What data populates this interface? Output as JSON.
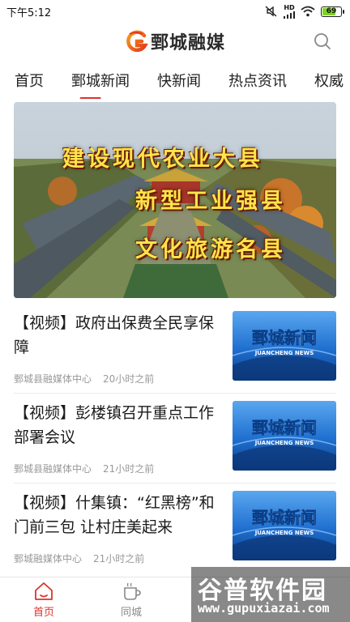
{
  "status_bar": {
    "time": "下午5:12",
    "network": "HD",
    "battery": "69"
  },
  "header": {
    "app_name": "鄄城融媒"
  },
  "tabs": [
    {
      "label": "首页"
    },
    {
      "label": "鄄城新闻"
    },
    {
      "label": "快新闻"
    },
    {
      "label": "热点资讯"
    },
    {
      "label": "权威"
    }
  ],
  "banner": {
    "lines": [
      "建设现代农业大县",
      "新型工业强县",
      "文化旅游名县"
    ]
  },
  "news": [
    {
      "title": "【视频】政府出保费全民享保障",
      "source": "鄄城县融媒体中心",
      "time": "20小时之前",
      "thumb_title": "鄄城新闻",
      "thumb_sub": "JUANCHENG NEWS"
    },
    {
      "title": "【视频】彭楼镇召开重点工作部署会议",
      "source": "鄄城县融媒体中心",
      "time": "21小时之前",
      "thumb_title": "鄄城新闻",
      "thumb_sub": "JUANCHENG NEWS"
    },
    {
      "title": "【视频】什集镇：“红黑榜”和门前三包 让村庄美起来",
      "source": "鄄城融媒体中心",
      "time": "21小时之前",
      "thumb_title": "鄄城新闻",
      "thumb_sub": "JUANCHENG NEWS"
    }
  ],
  "bottom_nav": [
    {
      "label": "首页",
      "icon": "home-icon"
    },
    {
      "label": "同城",
      "icon": "coffee-cup-icon"
    }
  ],
  "watermark": {
    "big": "谷普软件园",
    "small": "www.gupuxiazai.com"
  },
  "colors": {
    "accent": "#e0322b",
    "thumb_blue": "#1f6fd0"
  }
}
